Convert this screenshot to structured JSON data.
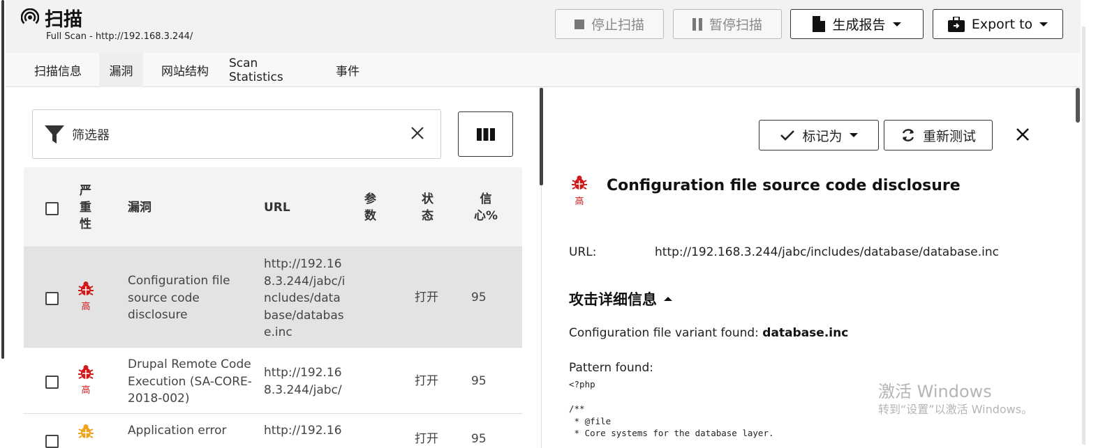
{
  "header": {
    "title": "扫描",
    "subtitle": "Full Scan - http://192.168.3.244/",
    "buttons": {
      "stop_label": "停止扫描",
      "pause_label": "暂停扫描",
      "report_label": "生成报告",
      "export_label": "Export to"
    }
  },
  "tabs": [
    {
      "label": "扫描信息",
      "active": false
    },
    {
      "label": "漏洞",
      "active": true
    },
    {
      "label": "网站结构",
      "active": false
    },
    {
      "label": "Scan Statistics",
      "active": false
    },
    {
      "label": "事件",
      "active": false
    }
  ],
  "filter": {
    "placeholder": "筛选器"
  },
  "table": {
    "headers": {
      "severity": "严重性",
      "vulnerability": "漏洞",
      "url": "URL",
      "params": "参数",
      "status": "状态",
      "confidence": "信心%"
    },
    "rows": [
      {
        "severity": "高",
        "severity_color": "#d0191b",
        "vulnerability": "Configuration file source code disclosure",
        "url": "http://192.168.3.244/jabc/includes/database/database.inc",
        "params": "",
        "status": "打开",
        "confidence": "95",
        "selected": true
      },
      {
        "severity": "高",
        "severity_color": "#d0191b",
        "vulnerability": "Drupal Remote Code Execution (SA-CORE-2018-002)",
        "url": "http://192.168.3.244/jabc/",
        "params": "",
        "status": "打开",
        "confidence": "95",
        "selected": false
      },
      {
        "severity": "",
        "severity_color": "#f0a31c",
        "vulnerability": "Application error",
        "url": "http://192.16",
        "params": "",
        "status": "打开",
        "confidence": "95",
        "selected": false
      }
    ]
  },
  "detail": {
    "mark_label": "标记为",
    "retest_label": "重新测试",
    "severity": "高",
    "title": "Configuration file source code disclosure",
    "url_label": "URL:",
    "url_value": "http://192.168.3.244/jabc/includes/database/database.inc",
    "attack_heading": "攻击详细信息",
    "variant_prefix": "Configuration file variant found: ",
    "variant_value": "database.inc",
    "pattern_label": "Pattern found:",
    "code": "<?php\n\n/**\n * @file\n * Core systems for the database layer."
  },
  "watermark": {
    "line1": "激活 Windows",
    "line2": "转到“设置”以激活 Windows。"
  },
  "colors": {
    "high": "#d0191b",
    "medium": "#f0a31c",
    "header_bg": "#f2f2f2"
  }
}
